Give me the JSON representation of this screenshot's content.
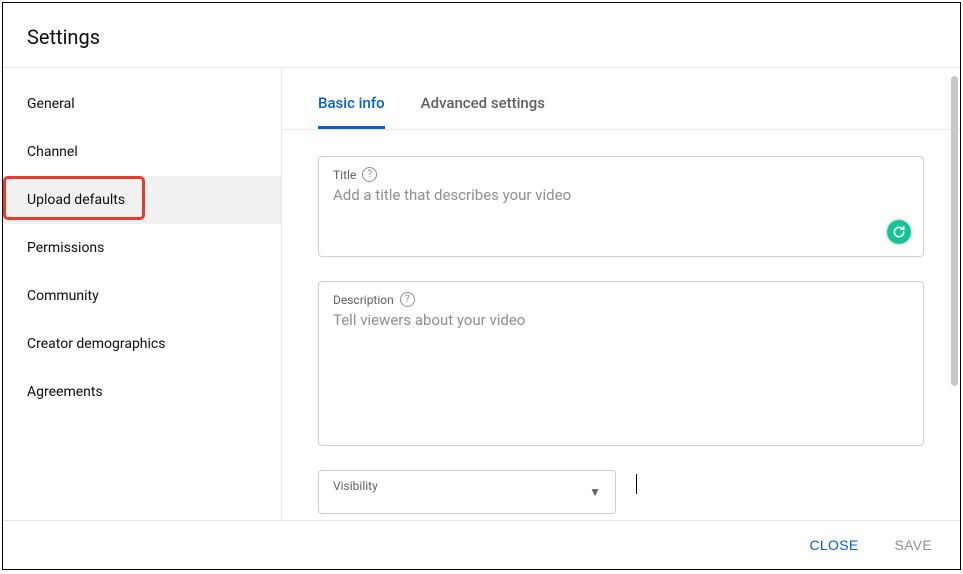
{
  "header": {
    "title": "Settings"
  },
  "sidebar": {
    "items": [
      {
        "label": "General"
      },
      {
        "label": "Channel"
      },
      {
        "label": "Upload defaults"
      },
      {
        "label": "Permissions"
      },
      {
        "label": "Community"
      },
      {
        "label": "Creator demographics"
      },
      {
        "label": "Agreements"
      }
    ]
  },
  "tabs": {
    "basic": "Basic info",
    "advanced": "Advanced settings"
  },
  "fields": {
    "title": {
      "label": "Title",
      "placeholder": "Add a title that describes your video",
      "value": ""
    },
    "description": {
      "label": "Description",
      "placeholder": "Tell viewers about your video",
      "value": ""
    },
    "visibility": {
      "label": "Visibility"
    }
  },
  "footer": {
    "close": "CLOSE",
    "save": "SAVE"
  },
  "colors": {
    "primary": "#065fd4",
    "highlight": "#e83b2f",
    "grammarly": "#15c39a"
  }
}
